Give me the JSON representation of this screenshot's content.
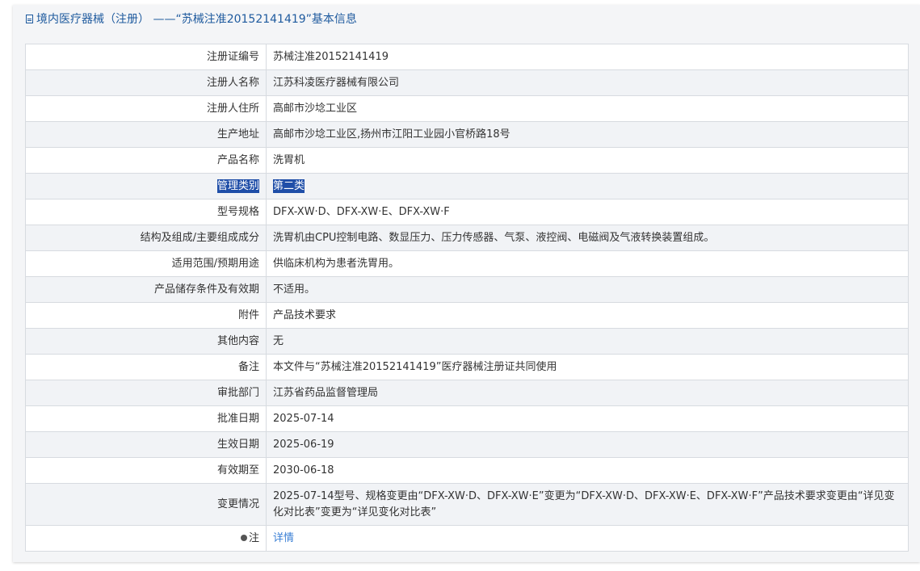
{
  "header": {
    "title": "境内医疗器械（注册） ——“苏械注准20152141419”基本信息",
    "icon": "document-icon"
  },
  "rows": [
    {
      "label": "注册证编号",
      "value": "苏械注准20152141419"
    },
    {
      "label": "注册人名称",
      "value": "江苏科凌医疗器械有限公司"
    },
    {
      "label": "注册人住所",
      "value": "高邮市沙埝工业区"
    },
    {
      "label": "生产地址",
      "value": "高邮市沙埝工业区,扬州市江阳工业园小官桥路18号"
    },
    {
      "label": "产品名称",
      "value": "洗胃机"
    },
    {
      "label": "管理类别",
      "value": "第二类"
    },
    {
      "label": "型号规格",
      "value": "DFX-XW·D、DFX-XW·E、DFX-XW·F"
    },
    {
      "label": "结构及组成/主要组成成分",
      "value": "洗胃机由CPU控制电路、数显压力、压力传感器、气泵、液控阀、电磁阀及气液转换装置组成。"
    },
    {
      "label": "适用范围/预期用途",
      "value": "供临床机构为患者洗胃用。"
    },
    {
      "label": "产品储存条件及有效期",
      "value": "不适用。"
    },
    {
      "label": "附件",
      "value": "产品技术要求"
    },
    {
      "label": "其他内容",
      "value": "无"
    },
    {
      "label": "备注",
      "value": "本文件与“苏械注准20152141419”医疗器械注册证共同使用"
    },
    {
      "label": "审批部门",
      "value": "江苏省药品监督管理局"
    },
    {
      "label": "批准日期",
      "value": "2025-07-14"
    },
    {
      "label": "生效日期",
      "value": "2025-06-19"
    },
    {
      "label": "有效期至",
      "value": "2030-06-18"
    },
    {
      "label": "变更情况",
      "value": "2025-07-14型号、规格变更由“DFX-XW·D、DFX-XW·E”变更为“DFX-XW·D、DFX-XW·E、DFX-XW·F”产品技术要求变更由“详见变化对比表”变更为“详见变化对比表”"
    },
    {
      "label": "注",
      "value": "详情",
      "icon": "lightbulb-icon"
    }
  ],
  "colors": {
    "header_text": "#1e5a9e",
    "link": "#3a7fd5",
    "selection": "#1f4ea8"
  }
}
